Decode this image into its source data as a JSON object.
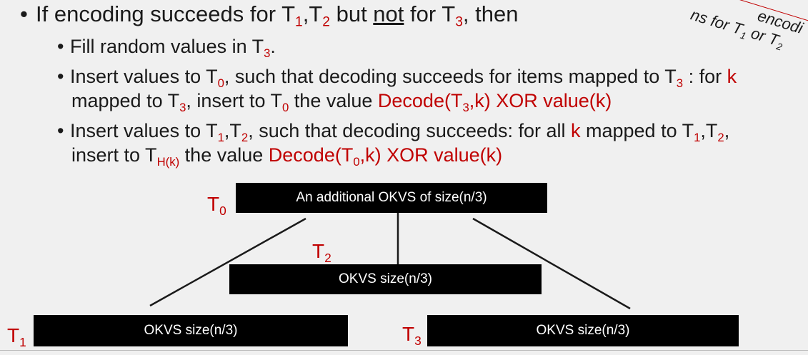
{
  "corner_note": {
    "line1": "encodi",
    "line2_a": "ns for T",
    "line2_sub1": "1",
    "line2_b": " or T",
    "line2_sub2": "2"
  },
  "bullet1": {
    "a": "If encoding succeeds for T",
    "s1": "1",
    "b": ",T",
    "s2": "2",
    "c": " but ",
    "not": "not",
    "d": " for T",
    "s3": "3",
    "e": ", then"
  },
  "bullet2": {
    "a": "Fill random values in T",
    "s1": "3",
    "b": "."
  },
  "bullet3": {
    "a": "Insert values to T",
    "s1": "0",
    "b": ", such that decoding succeeds for items mapped to T",
    "s2": "3",
    "c": " :  for ",
    "k": "k",
    "l2a": "mapped to T",
    "l2s1": "3",
    "l2b": ", insert to T",
    "l2s2": "0",
    "l2c": " the value ",
    "l2red": "Decode(T",
    "l2rsub": "3",
    "l2red2": ",k) XOR value(k)"
  },
  "bullet4": {
    "a": "Insert values to T",
    "s1": "1",
    "b": ",T",
    "s2": "2",
    "c": ", such that decoding succeeds:  for all ",
    "k": "k",
    "d": " mapped to T",
    "s3": "1",
    "e": ",T",
    "s4": "2",
    "f": ",",
    "l2a": "insert to T",
    "l2sub": "H(k)",
    "l2b": " the value  ",
    "l2red": "Decode(T",
    "l2rsub": "0",
    "l2red2": ",k) XOR value(k)"
  },
  "diagram": {
    "t0": {
      "letter": "T",
      "sub": "0",
      "box": "An additional OKVS of size(n/3)"
    },
    "t1": {
      "letter": "T",
      "sub": "1",
      "box": "OKVS size(n/3)"
    },
    "t2": {
      "letter": "T",
      "sub": "2",
      "box": "OKVS size(n/3)"
    },
    "t3": {
      "letter": "T",
      "sub": "3",
      "box": "OKVS size(n/3)"
    }
  }
}
